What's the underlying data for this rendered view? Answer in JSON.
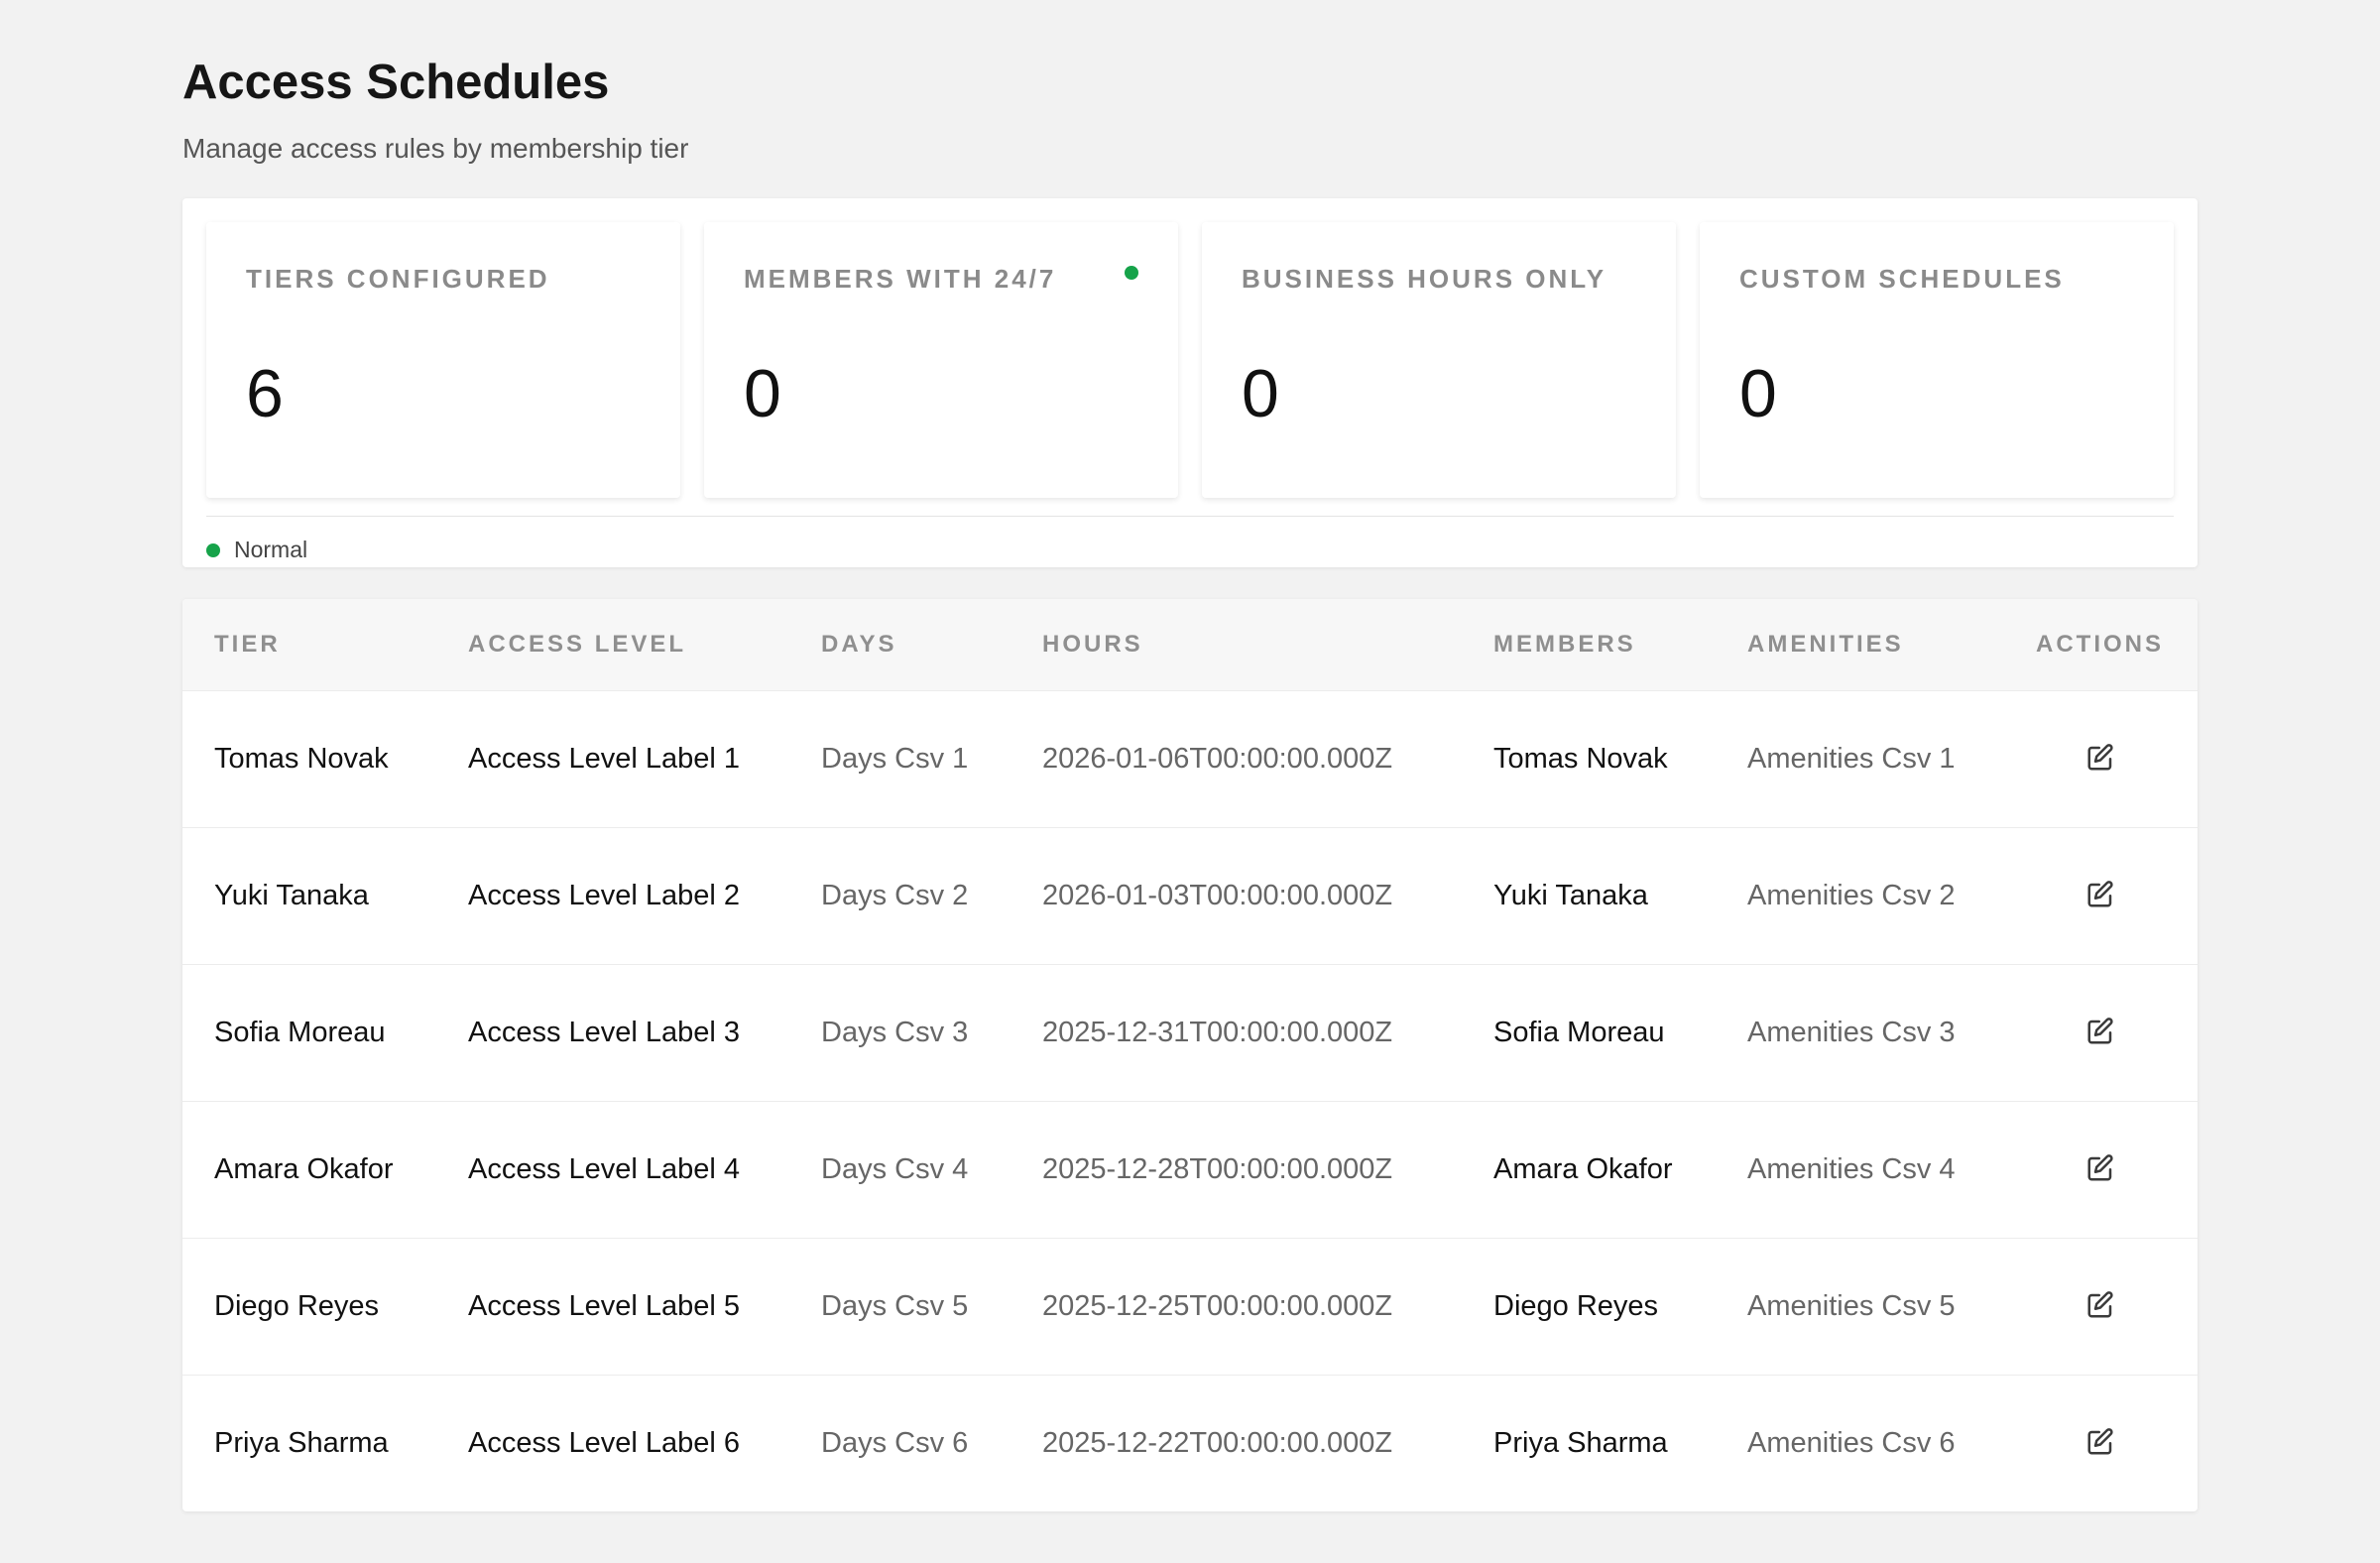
{
  "header": {
    "title": "Access Schedules",
    "subtitle": "Manage access rules by membership tier"
  },
  "stats": [
    {
      "label": "TIERS CONFIGURED",
      "value": "6"
    },
    {
      "label": "MEMBERS WITH 24/7",
      "value": "0",
      "indicator": "green-dot"
    },
    {
      "label": "BUSINESS HOURS ONLY",
      "value": "0"
    },
    {
      "label": "CUSTOM SCHEDULES",
      "value": "0"
    }
  ],
  "status": {
    "label": "Normal",
    "color": "#16a34a"
  },
  "table": {
    "columns": [
      "TIER",
      "ACCESS LEVEL",
      "DAYS",
      "HOURS",
      "MEMBERS",
      "AMENITIES",
      "ACTIONS"
    ],
    "rows": [
      {
        "tier": "Tomas Novak",
        "access_level": "Access Level Label 1",
        "days": "Days Csv 1",
        "hours": "2026-01-06T00:00:00.000Z",
        "members": "Tomas Novak",
        "amenities": "Amenities Csv 1",
        "action_icon": "edit-icon"
      },
      {
        "tier": "Yuki Tanaka",
        "access_level": "Access Level Label 2",
        "days": "Days Csv 2",
        "hours": "2026-01-03T00:00:00.000Z",
        "members": "Yuki Tanaka",
        "amenities": "Amenities Csv 2",
        "action_icon": "edit-icon"
      },
      {
        "tier": "Sofia Moreau",
        "access_level": "Access Level Label 3",
        "days": "Days Csv 3",
        "hours": "2025-12-31T00:00:00.000Z",
        "members": "Sofia Moreau",
        "amenities": "Amenities Csv 3",
        "action_icon": "edit-icon"
      },
      {
        "tier": "Amara Okafor",
        "access_level": "Access Level Label 4",
        "days": "Days Csv 4",
        "hours": "2025-12-28T00:00:00.000Z",
        "members": "Amara Okafor",
        "amenities": "Amenities Csv 4",
        "action_icon": "edit-icon"
      },
      {
        "tier": "Diego Reyes",
        "access_level": "Access Level Label 5",
        "days": "Days Csv 5",
        "hours": "2025-12-25T00:00:00.000Z",
        "members": "Diego Reyes",
        "amenities": "Amenities Csv 5",
        "action_icon": "edit-icon"
      },
      {
        "tier": "Priya Sharma",
        "access_level": "Access Level Label 6",
        "days": "Days Csv 6",
        "hours": "2025-12-22T00:00:00.000Z",
        "members": "Priya Sharma",
        "amenities": "Amenities Csv 6",
        "action_icon": "edit-icon"
      }
    ]
  }
}
